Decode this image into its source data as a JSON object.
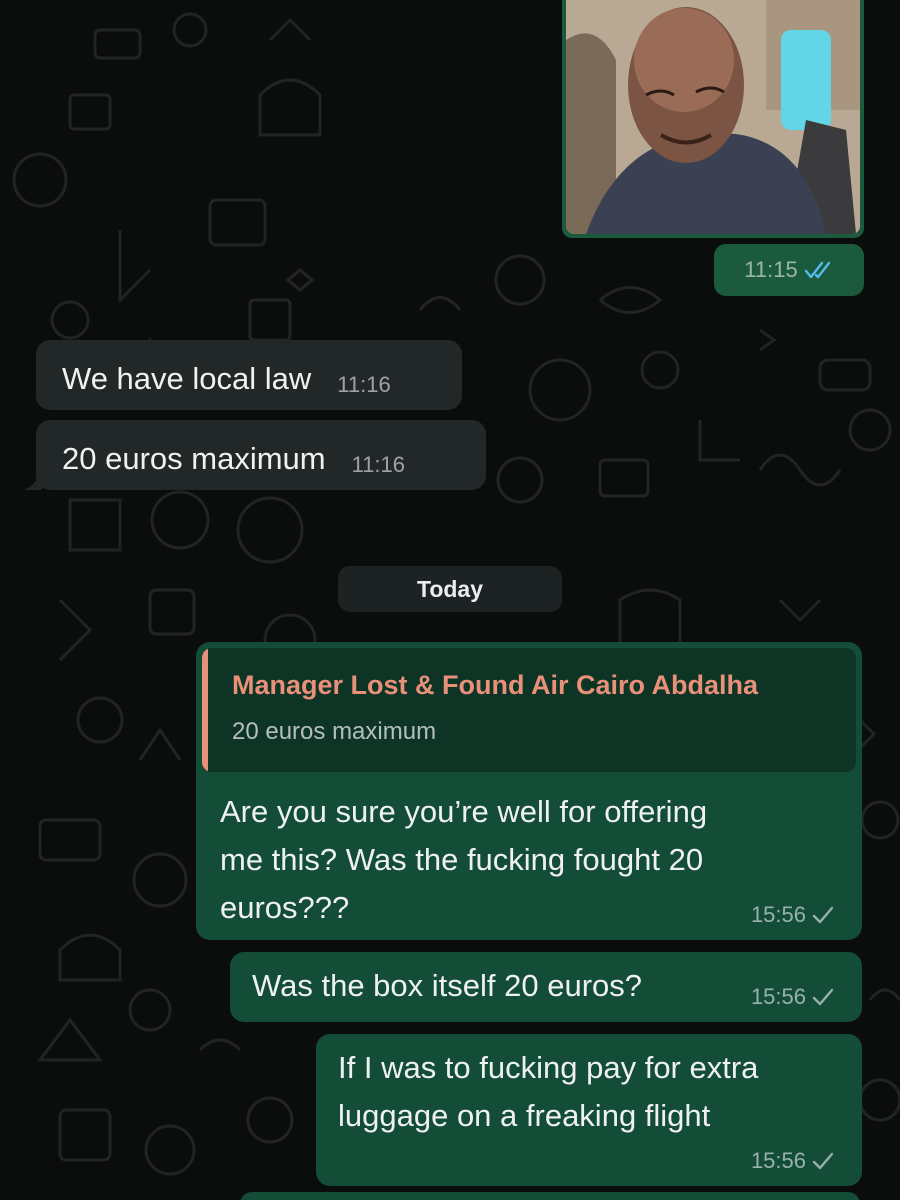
{
  "image_message": {
    "time": "11:15",
    "status": "read"
  },
  "incoming": [
    {
      "text": "We have local law",
      "time": "11:16"
    },
    {
      "text": "20 euros maximum",
      "time": "11:16"
    }
  ],
  "date_divider": "Today",
  "reply_message": {
    "quote_author": "Manager Lost & Found Air Cairo Abdalha",
    "quote_text": "20 euros maximum",
    "lines": [
      "Are you sure you’re well for offering",
      "me this? Was the fucking fought 20",
      "euros???"
    ],
    "time": "15:56",
    "status": "sent"
  },
  "outgoing_2": {
    "text": "Was the box itself 20 euros?",
    "time": "15:56",
    "status": "sent"
  },
  "outgoing_3": {
    "lines": [
      "If I was to fucking pay for extra",
      "luggage on a freaking flight"
    ],
    "time": "15:56",
    "status": "sent"
  },
  "colors": {
    "background": "#0b0c0c",
    "outgoing_bubble": "#144d37",
    "incoming_bubble": "#222727",
    "quote_accent": "#e8907a",
    "read_ticks": "#53bdeb"
  },
  "icons": [
    "double-check-read-icon",
    "single-check-icon"
  ]
}
